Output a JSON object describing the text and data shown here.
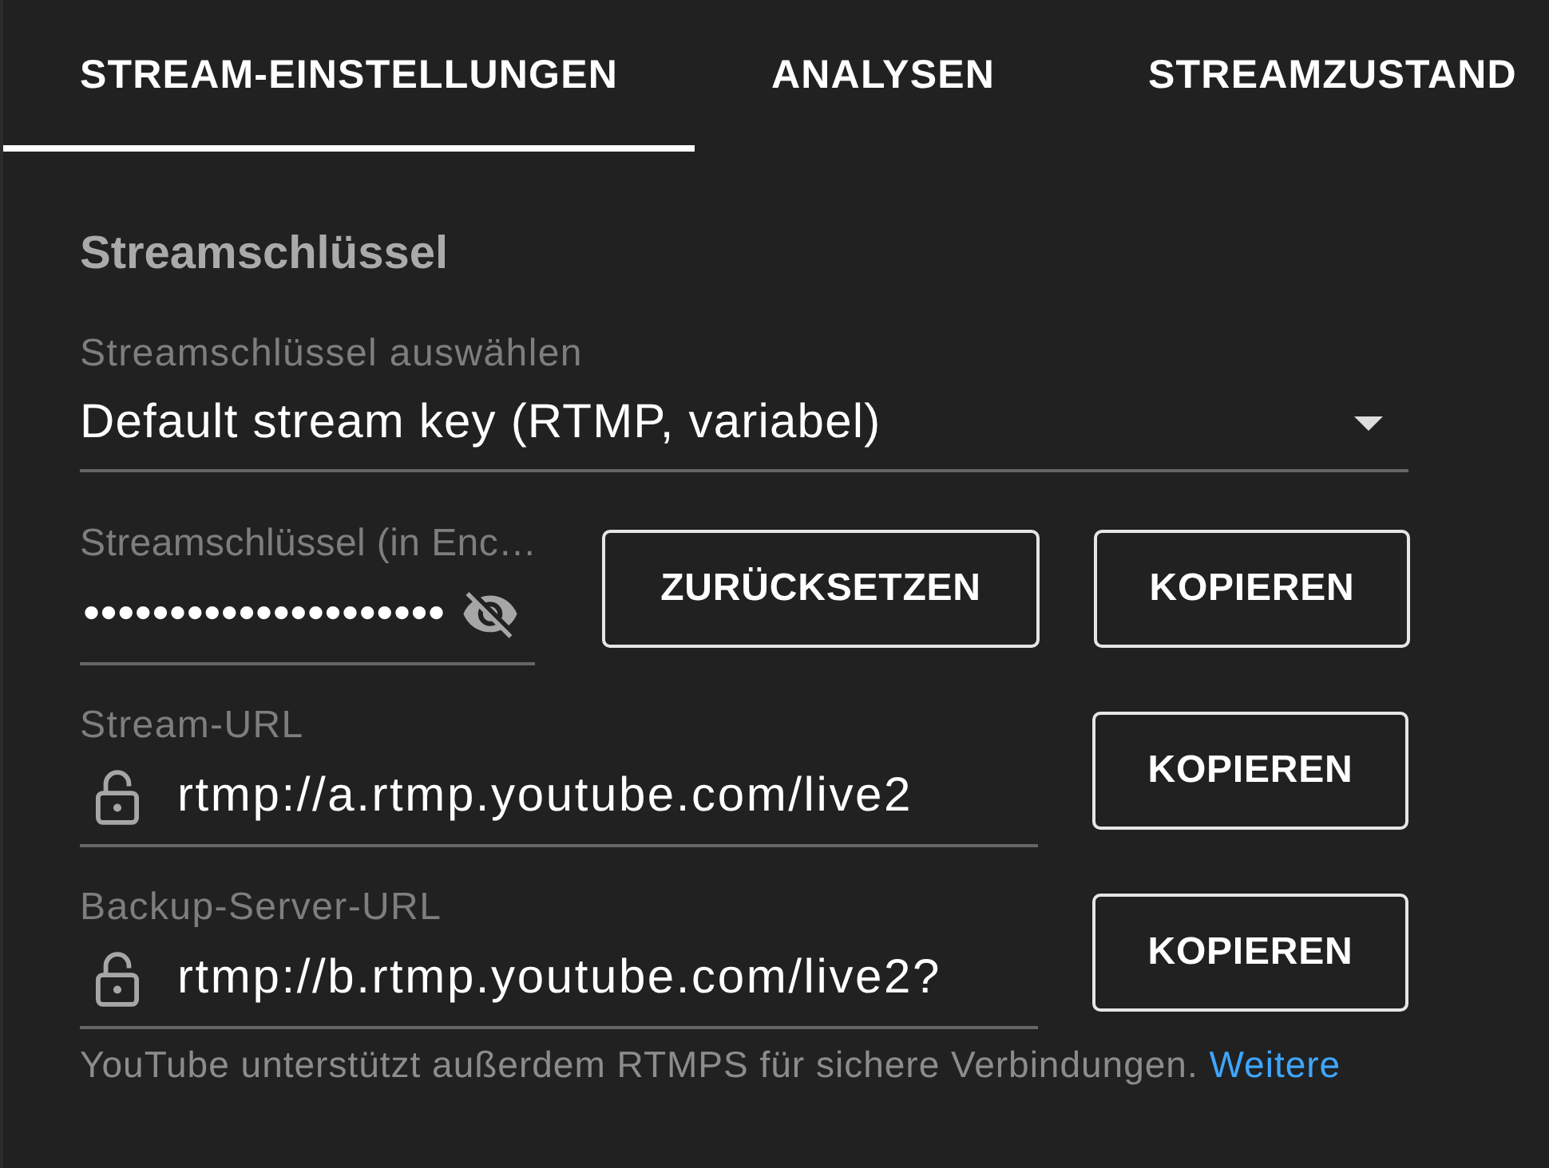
{
  "tabs": [
    {
      "label": "STREAM-EINSTELLUNGEN",
      "selected": true
    },
    {
      "label": "ANALYSEN",
      "selected": false
    },
    {
      "label": "STREAMZUSTAND",
      "selected": false
    }
  ],
  "stream_key_section": {
    "title": "Streamschlüssel",
    "key_select": {
      "label": "Streamschlüssel auswählen",
      "value": "Default stream key (RTMP, variabel)"
    },
    "stream_key": {
      "label": "Streamschlüssel (in Enc…",
      "value": "•••••••••••••••••••••",
      "visible": false,
      "buttons": [
        "ZURÜCKSETZEN",
        "KOPIEREN"
      ]
    },
    "urls": [
      {
        "label": "Stream-URL",
        "value": "rtmp://a.rtmp.youtube.com/live2",
        "button": "KOPIEREN"
      },
      {
        "label": "Backup-Server-URL",
        "value": "rtmp://b.rtmp.youtube.com/live2?",
        "button": "KOPIEREN"
      }
    ],
    "note": {
      "text": "YouTube unterstützt außerdem RTMPS für sichere Verbindungen.",
      "link": "Weitere"
    }
  }
}
